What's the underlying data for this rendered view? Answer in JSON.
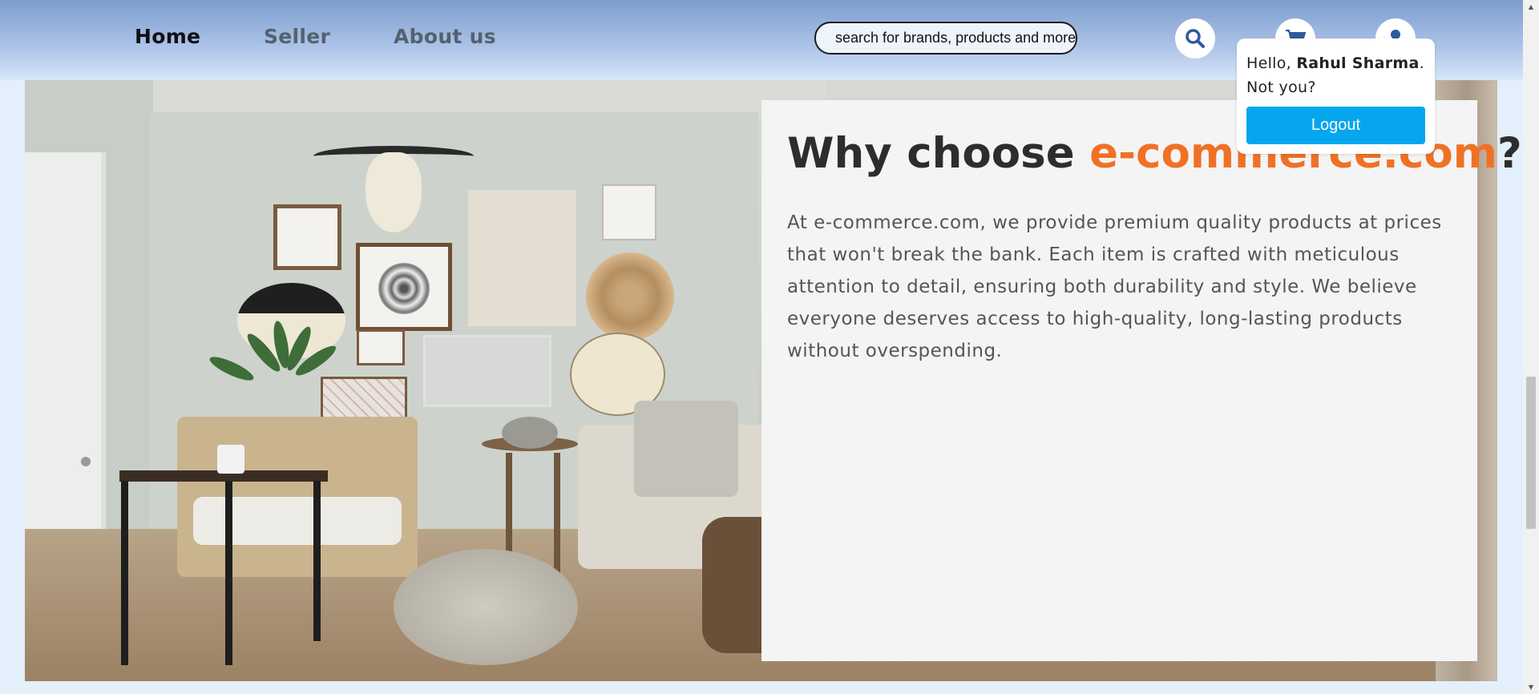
{
  "nav": {
    "items": [
      {
        "label": "Home",
        "active": true
      },
      {
        "label": "Seller",
        "active": false
      },
      {
        "label": "About us",
        "active": false
      }
    ]
  },
  "search": {
    "placeholder": "search for brands, products and more",
    "icon": "search-icon"
  },
  "header_icons": [
    "cart-icon",
    "user-icon"
  ],
  "colors": {
    "header_top": "#7e9ccd",
    "header_bottom": "#d7e6f8",
    "brand_accent": "#f07126",
    "logout_button": "#06a6ee",
    "page_background": "#e3effb",
    "icon_color": "#2e5a9c"
  },
  "user_menu": {
    "greeting": "Hello,",
    "user_name": "Rahul Sharma",
    "suffix": ".",
    "not_you": "Not you?",
    "logout_label": "Logout"
  },
  "hero": {
    "image_description_icon": "living-room-image",
    "title_prefix": "Why choose ",
    "title_brand": "e-commerce.com",
    "title_suffix": "?",
    "description": "At e-commerce.com, we provide premium quality products at prices that won't break the bank. Each item is crafted with meticulous attention to detail, ensuring both durability and style. We believe everyone deserves access to high-quality, long-lasting products without overspending."
  }
}
